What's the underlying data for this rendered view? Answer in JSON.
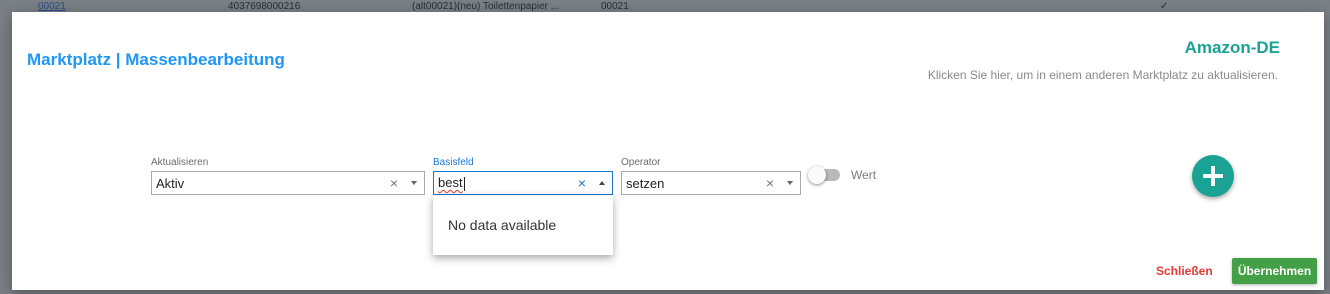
{
  "background_table": {
    "top_row": {
      "id": "00021",
      "ean": "4037698000216",
      "name": "(alt00021)(neu) Toilettenpapier ...",
      "sku": "00021",
      "check": "✓"
    }
  },
  "dialog": {
    "title": "Marktplatz | Massenbearbeitung",
    "marketplace": "Amazon-DE",
    "marketplace_hint": "Klicken Sie hier, um in einem anderen Marktplatz zu aktualisieren."
  },
  "fields": {
    "aktualisieren": {
      "label": "Aktualisieren",
      "value": "Aktiv"
    },
    "basisfeld": {
      "label": "Basisfeld",
      "value": "best"
    },
    "operator": {
      "label": "Operator",
      "value": "setzen"
    }
  },
  "dropdown": {
    "empty_text": "No data available"
  },
  "toggle": {
    "label": "Wert",
    "checked": false
  },
  "actions": {
    "close_label": "Schließen",
    "apply_label": "Übernehmen"
  },
  "icons": {
    "clear": "×",
    "add": "plus-icon"
  },
  "colors": {
    "title": "#2196f3",
    "marketplace": "#1aa394",
    "add_button": "#1aa394",
    "close": "#e53935",
    "apply": "#43a047",
    "focus": "#1976d2"
  }
}
